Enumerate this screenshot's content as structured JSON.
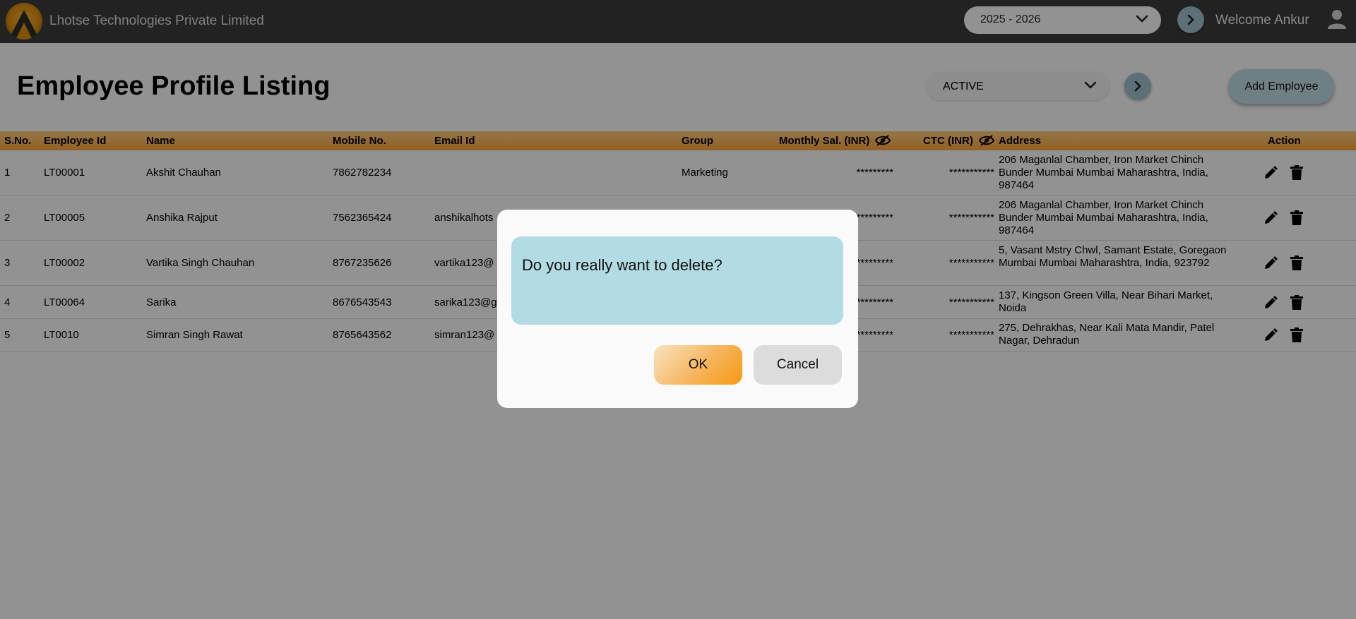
{
  "header": {
    "company_name": "Lhotse Technologies Private Limited",
    "financial_year": "2025 - 2026",
    "welcome_text": "Welcome Ankur"
  },
  "page": {
    "title": "Employee Profile Listing",
    "status_filter": "ACTIVE",
    "add_button_label": "Add Employee"
  },
  "table": {
    "columns": {
      "sno": "S.No.",
      "employee_id": "Employee Id",
      "name": "Name",
      "mobile": "Mobile No.",
      "email": "Email Id",
      "group": "Group",
      "monthly_salary": "Monthly Sal. (INR)",
      "ctc": "CTC (INR)",
      "address": "Address",
      "action": "Action"
    },
    "rows": [
      {
        "sno": "1",
        "employee_id": "LT00001",
        "name": "Akshit Chauhan",
        "mobile": "7862782234",
        "email": "",
        "group": "Marketing",
        "monthly_salary": "*********",
        "ctc": "***********",
        "address": "206 Maganlal Chamber, Iron Market Chinch Bunder Mumbai Mumbai Maharashtra, India, 987464"
      },
      {
        "sno": "2",
        "employee_id": "LT00005",
        "name": "Anshika Rajput",
        "mobile": "7562365424",
        "email": "anshikalhots",
        "group": "",
        "monthly_salary": "*********",
        "ctc": "***********",
        "address": "206 Maganlal Chamber, Iron Market Chinch Bunder Mumbai Mumbai Maharashtra, India, 987464"
      },
      {
        "sno": "3",
        "employee_id": "LT00002",
        "name": "Vartika Singh Chauhan",
        "mobile": "8767235626",
        "email": "vartika123@",
        "group": "",
        "monthly_salary": "*********",
        "ctc": "***********",
        "address": "5, Vasant Mstry Chwl, Samant Estate, Goregaon Mumbai Mumbai Maharashtra, India, 923792"
      },
      {
        "sno": "4",
        "employee_id": "LT00064",
        "name": "Sarika",
        "mobile": "8676543543",
        "email": "sarika123@g",
        "group": "",
        "monthly_salary": "*********",
        "ctc": "***********",
        "address": "137, Kingson Green Villa, Near Bihari Market, Noida"
      },
      {
        "sno": "5",
        "employee_id": "LT0010",
        "name": "Simran Singh Rawat",
        "mobile": "8765643562",
        "email": "simran123@",
        "group": "",
        "monthly_salary": "*********",
        "ctc": "***********",
        "address": "275, Dehrakhas, Near Kali Mata Mandir, Patel Nagar, Dehradun"
      }
    ]
  },
  "dialog": {
    "message": "Do you really want to delete?",
    "ok_label": "OK",
    "cancel_label": "Cancel"
  },
  "colors": {
    "topbar": "#3a3a3a",
    "table_header": "#f5a23a",
    "dialog_message_bg": "#b3dbe4",
    "ok_button": "#f79a12",
    "overlay": "rgba(0,0,0,0.4)"
  },
  "icons": {
    "logo": "mountain-logo-icon",
    "dropdown": "chevron-down-icon",
    "go": "chevron-right-icon",
    "user": "user-icon",
    "hide": "eye-off-icon",
    "edit": "pencil-icon",
    "delete": "trash-icon"
  }
}
